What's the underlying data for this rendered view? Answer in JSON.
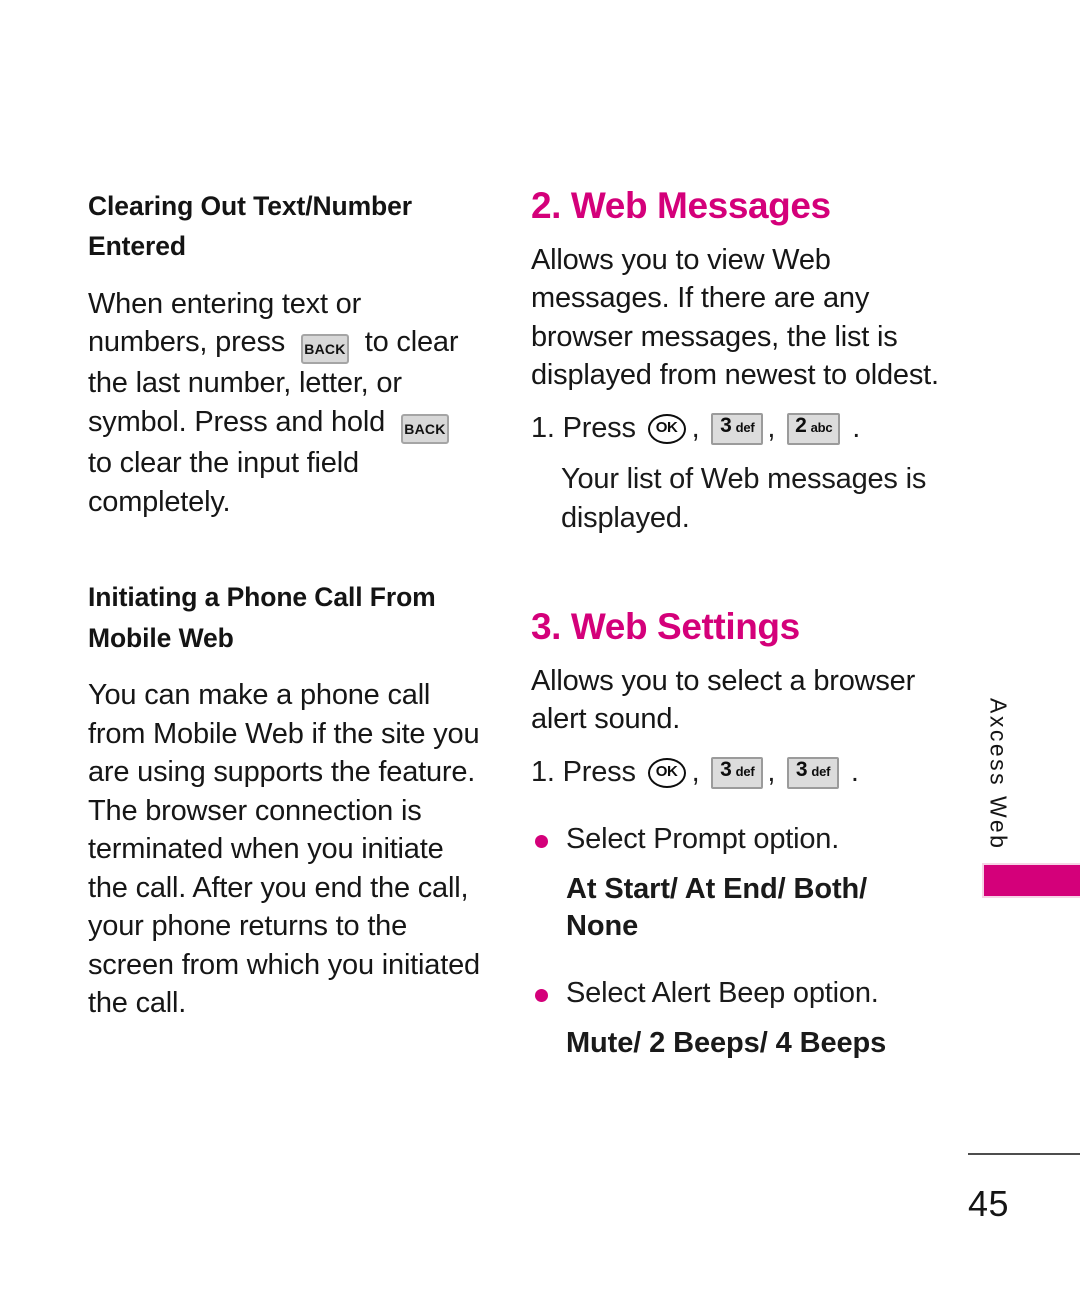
{
  "document": {
    "page_number": "45",
    "side_tab_label": "Axcess Web",
    "accent_color": "#D4007A"
  },
  "left_column": {
    "section1": {
      "heading": "Clearing Out Text/Number Entered",
      "paragraph_part1": "When entering text or numbers, press ",
      "key1": "BACK",
      "paragraph_part2": " to clear the last number, letter, or symbol. Press and hold ",
      "key2": "BACK",
      "paragraph_part3": " to clear the input field completely."
    },
    "section2": {
      "heading": "Initiating a Phone Call From Mobile Web",
      "paragraph": "You can make a phone call from Mobile Web if the site you are using supports the feature. The browser connection is terminated when you initiate the call. After you end the call, your phone returns to the screen from which you initiated the call."
    }
  },
  "right_column": {
    "section_web_messages": {
      "heading": "2. Web Messages",
      "paragraph": "Allows you to view Web messages. If there are any browser messages, the list is displayed from newest to oldest.",
      "step": {
        "lead": "1. Press ",
        "key_ok": "OK",
        "comma1": ", ",
        "key2_digit": "3",
        "key2_letters": "def",
        "comma2": ", ",
        "key3_digit": "2",
        "key3_letters": "abc",
        "period": " ."
      },
      "note": "Your list of Web messages is displayed."
    },
    "section_web_settings": {
      "heading": "3. Web Settings",
      "paragraph": "Allows you to select a browser alert sound.",
      "step": {
        "lead": "1. Press ",
        "key_ok": "OK",
        "comma1": ", ",
        "key2_digit": "3",
        "key2_letters": "def",
        "comma2": ", ",
        "key3_digit": "3",
        "key3_letters": "def",
        "period": " ."
      },
      "bullets": [
        {
          "text": "Select Prompt option.",
          "value": "At Start/ At End/ Both/ None"
        },
        {
          "text": "Select Alert Beep option.",
          "value": "Mute/ 2 Beeps/ 4 Beeps"
        }
      ]
    }
  }
}
